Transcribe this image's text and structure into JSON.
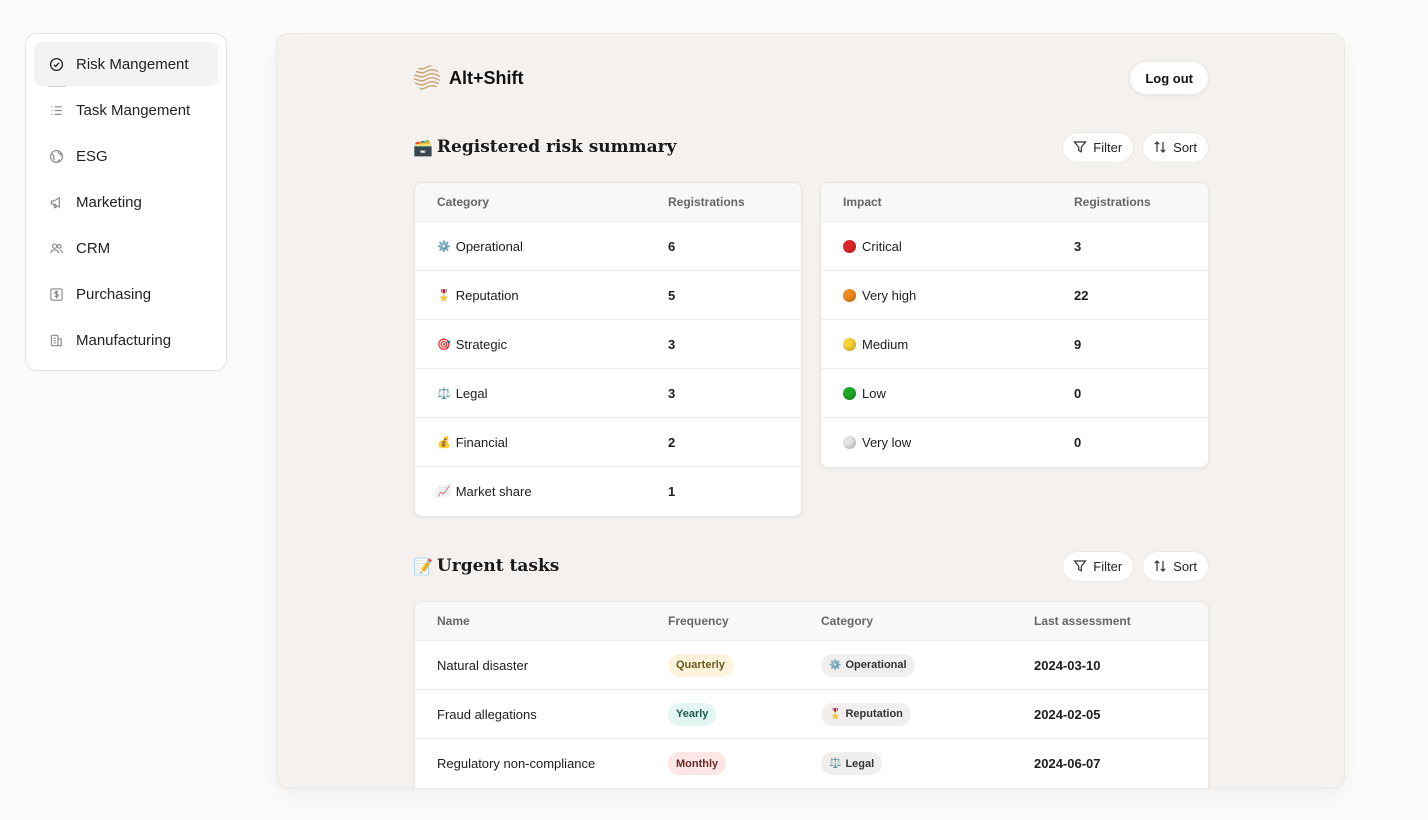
{
  "sidebar": {
    "items": [
      {
        "label": "Risk Mangement",
        "icon": "check-circle-icon",
        "active": true
      },
      {
        "label": "Task Mangement",
        "icon": "list-icon",
        "active": false
      },
      {
        "label": "ESG",
        "icon": "globe-icon",
        "active": false
      },
      {
        "label": "Marketing",
        "icon": "megaphone-icon",
        "active": false
      },
      {
        "label": "CRM",
        "icon": "users-icon",
        "active": false
      },
      {
        "label": "Purchasing",
        "icon": "dollar-square-icon",
        "active": false
      },
      {
        "label": "Manufacturing",
        "icon": "factory-icon",
        "active": false
      }
    ]
  },
  "header": {
    "brand": "Alt+Shift",
    "logout_label": "Log out"
  },
  "risk_summary": {
    "emoji": "🗃️",
    "title": "Registered risk summary",
    "filter_label": "Filter",
    "sort_label": "Sort",
    "category_table": {
      "headers": [
        "Category",
        "Registrations"
      ],
      "rows": [
        {
          "emoji": "⚙️",
          "name": "Operational",
          "count": "6"
        },
        {
          "emoji": "🎖️",
          "name": "Reputation",
          "count": "5"
        },
        {
          "emoji": "🎯",
          "name": "Strategic",
          "count": "3"
        },
        {
          "emoji": "⚖️",
          "name": "Legal",
          "count": "3"
        },
        {
          "emoji": "💰",
          "name": "Financial",
          "count": "2"
        },
        {
          "emoji": "📈",
          "name": "Market share",
          "count": "1"
        }
      ]
    },
    "impact_table": {
      "headers": [
        "Impact",
        "Registrations"
      ],
      "rows": [
        {
          "color": "#e0262b",
          "name": "Critical",
          "count": "3"
        },
        {
          "color": "#f08a1c",
          "name": "Very high",
          "count": "22"
        },
        {
          "color": "#f7d233",
          "name": "Medium",
          "count": "9"
        },
        {
          "color": "#1fa827",
          "name": "Low",
          "count": "0"
        },
        {
          "color": "#e4e4e4",
          "name": "Very low",
          "count": "0"
        }
      ]
    }
  },
  "urgent_tasks": {
    "emoji": "📝",
    "title": "Urgent tasks",
    "filter_label": "Filter",
    "sort_label": "Sort",
    "headers": [
      "Name",
      "Frequency",
      "Category",
      "Last assessment"
    ],
    "rows": [
      {
        "name": "Natural disaster",
        "frequency": "Quarterly",
        "freq_bg": "#fdf3dc",
        "freq_color": "#6b5a1e",
        "cat_emoji": "⚙️",
        "category": "Operational",
        "last": "2024-03-10"
      },
      {
        "name": "Fraud allegations",
        "frequency": "Yearly",
        "freq_bg": "#e3f6f3",
        "freq_color": "#1e5a52",
        "cat_emoji": "🎖️",
        "category": "Reputation",
        "last": "2024-02-05"
      },
      {
        "name": "Regulatory non-compliance",
        "frequency": "Monthly",
        "freq_bg": "#fce7e6",
        "freq_color": "#6b2b27",
        "cat_emoji": "⚖️",
        "category": "Legal",
        "last": "2024-06-07"
      }
    ]
  }
}
